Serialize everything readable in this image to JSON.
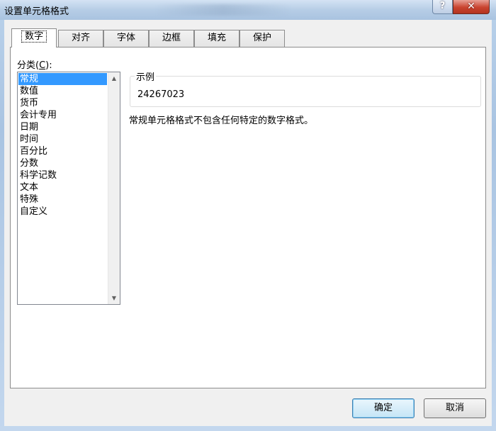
{
  "window": {
    "title": "设置单元格格式"
  },
  "titlebar_buttons": {
    "help": "?",
    "close": "✕"
  },
  "tabs": [
    {
      "label": "数字",
      "active": true
    },
    {
      "label": "对齐"
    },
    {
      "label": "字体"
    },
    {
      "label": "边框"
    },
    {
      "label": "填充"
    },
    {
      "label": "保护"
    }
  ],
  "category": {
    "label_prefix": "分类(",
    "label_hotkey": "C",
    "label_suffix": "):",
    "items": [
      "常规",
      "数值",
      "货币",
      "会计专用",
      "日期",
      "时间",
      "百分比",
      "分数",
      "科学记数",
      "文本",
      "特殊",
      "自定义"
    ],
    "selected": "常规"
  },
  "sample": {
    "legend": "示例",
    "value": "24267023"
  },
  "description": "常规单元格格式不包含任何特定的数字格式。",
  "buttons": {
    "ok": "确定",
    "cancel": "取消"
  },
  "icons": {
    "scroll_up": "up-arrow-icon",
    "scroll_down": "down-arrow-icon"
  },
  "colors": {
    "selection": "#3399ff",
    "close_button": "#c9432f"
  }
}
